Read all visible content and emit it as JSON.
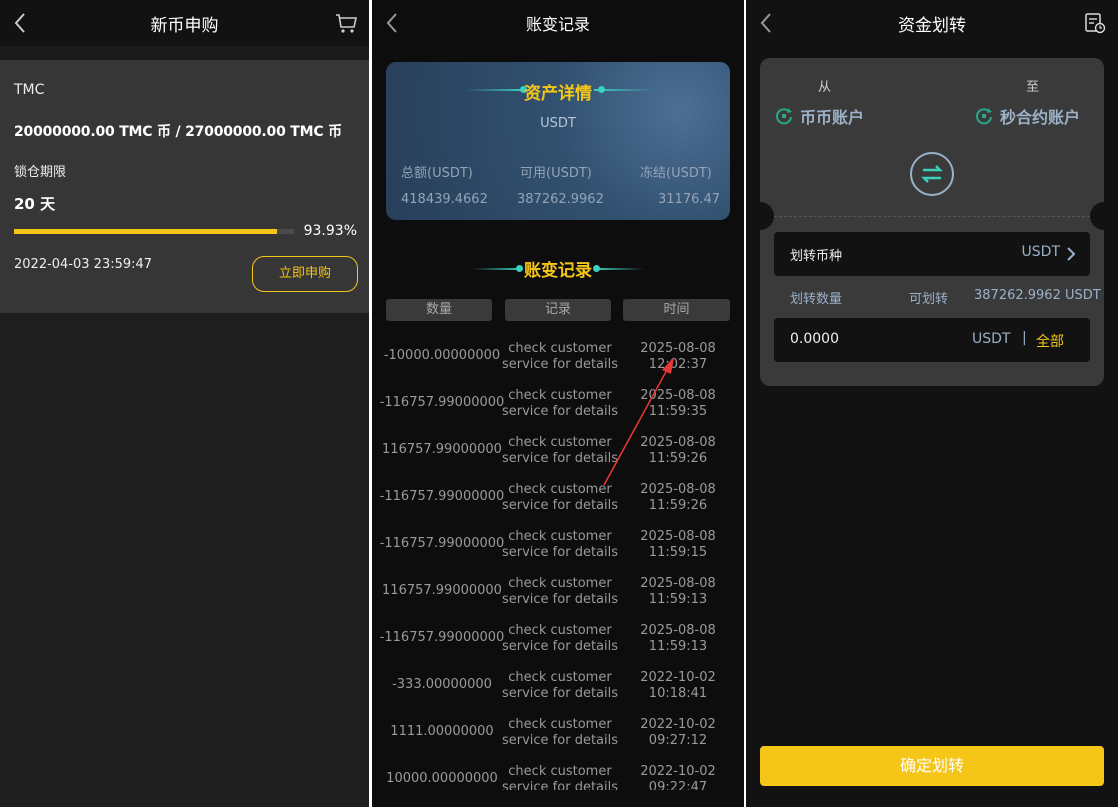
{
  "subscribe": {
    "title": "新币申购",
    "coin_name": "TMC",
    "amount_text": "20000000.00 TMC 币 / 27000000.00 TMC 币",
    "lock_label": "锁仓期限",
    "lock_value": "20 天",
    "progress": 0.9393,
    "progress_text": "93.93%",
    "deadline": "2022-04-03 23:59:47",
    "button_label": "立即申购",
    "icons": {
      "back": "chevron-left-icon",
      "cart": "cart-icon"
    }
  },
  "records": {
    "title": "账变记录",
    "asset_title": "资产详情",
    "asset_coin": "USDT",
    "total_label": "总额(USDT)",
    "available_label": "可用(USDT)",
    "frozen_label": "冻结(USDT)",
    "total_value": "418439.4662",
    "available_value": "387262.9962",
    "frozen_value": "31176.47",
    "list_title": "账变记录",
    "columns": [
      "数量",
      "记录",
      "时间"
    ],
    "rows": [
      {
        "qty": "-10000.00000000",
        "rec": [
          "check customer",
          "service for details"
        ],
        "time": [
          "2025-08-08",
          "12:02:37"
        ]
      },
      {
        "qty": "-116757.99000000",
        "rec": [
          "check customer",
          "service for details"
        ],
        "time": [
          "2025-08-08",
          "11:59:35"
        ]
      },
      {
        "qty": "116757.99000000",
        "rec": [
          "check customer",
          "service for details"
        ],
        "time": [
          "2025-08-08",
          "11:59:26"
        ]
      },
      {
        "qty": "-116757.99000000",
        "rec": [
          "check customer",
          "service for details"
        ],
        "time": [
          "2025-08-08",
          "11:59:26"
        ]
      },
      {
        "qty": "-116757.99000000",
        "rec": [
          "check customer",
          "service for details"
        ],
        "time": [
          "2025-08-08",
          "11:59:15"
        ]
      },
      {
        "qty": "116757.99000000",
        "rec": [
          "check customer",
          "service for details"
        ],
        "time": [
          "2025-08-08",
          "11:59:13"
        ]
      },
      {
        "qty": "-116757.99000000",
        "rec": [
          "check customer",
          "service for details"
        ],
        "time": [
          "2025-08-08",
          "11:59:13"
        ]
      },
      {
        "qty": "-333.00000000",
        "rec": [
          "check customer",
          "service for details"
        ],
        "time": [
          "2022-10-02",
          "10:18:41"
        ]
      },
      {
        "qty": "1111.00000000",
        "rec": [
          "check customer",
          "service for details"
        ],
        "time": [
          "2022-10-02",
          "09:27:12"
        ]
      },
      {
        "qty": "10000.00000000",
        "rec": [
          "check customer",
          "service for details"
        ],
        "time": [
          "2022-10-02",
          "09:22:47"
        ]
      }
    ]
  },
  "transfer": {
    "title": "资金划转",
    "from_label": "从",
    "to_label": "至",
    "from_account": "币币账户",
    "to_account": "秒合约账户",
    "coin_label": "划转币种",
    "coin_value": "USDT",
    "amount_label": "划转数量",
    "available_label": "可划转",
    "available_value": "387262.9962 USDT",
    "amount_value": "0.0000",
    "amount_unit": "USDT",
    "separator": "|",
    "all_label": "全部",
    "confirm_label": "确定划转",
    "icons": {
      "records": "record-list-icon",
      "swap": "swap-icon",
      "account": "refresh-circle-icon"
    }
  },
  "colors": {
    "accent": "#f5c518",
    "teal": "#3ad1c0",
    "blue_text": "#9bb1c8"
  }
}
